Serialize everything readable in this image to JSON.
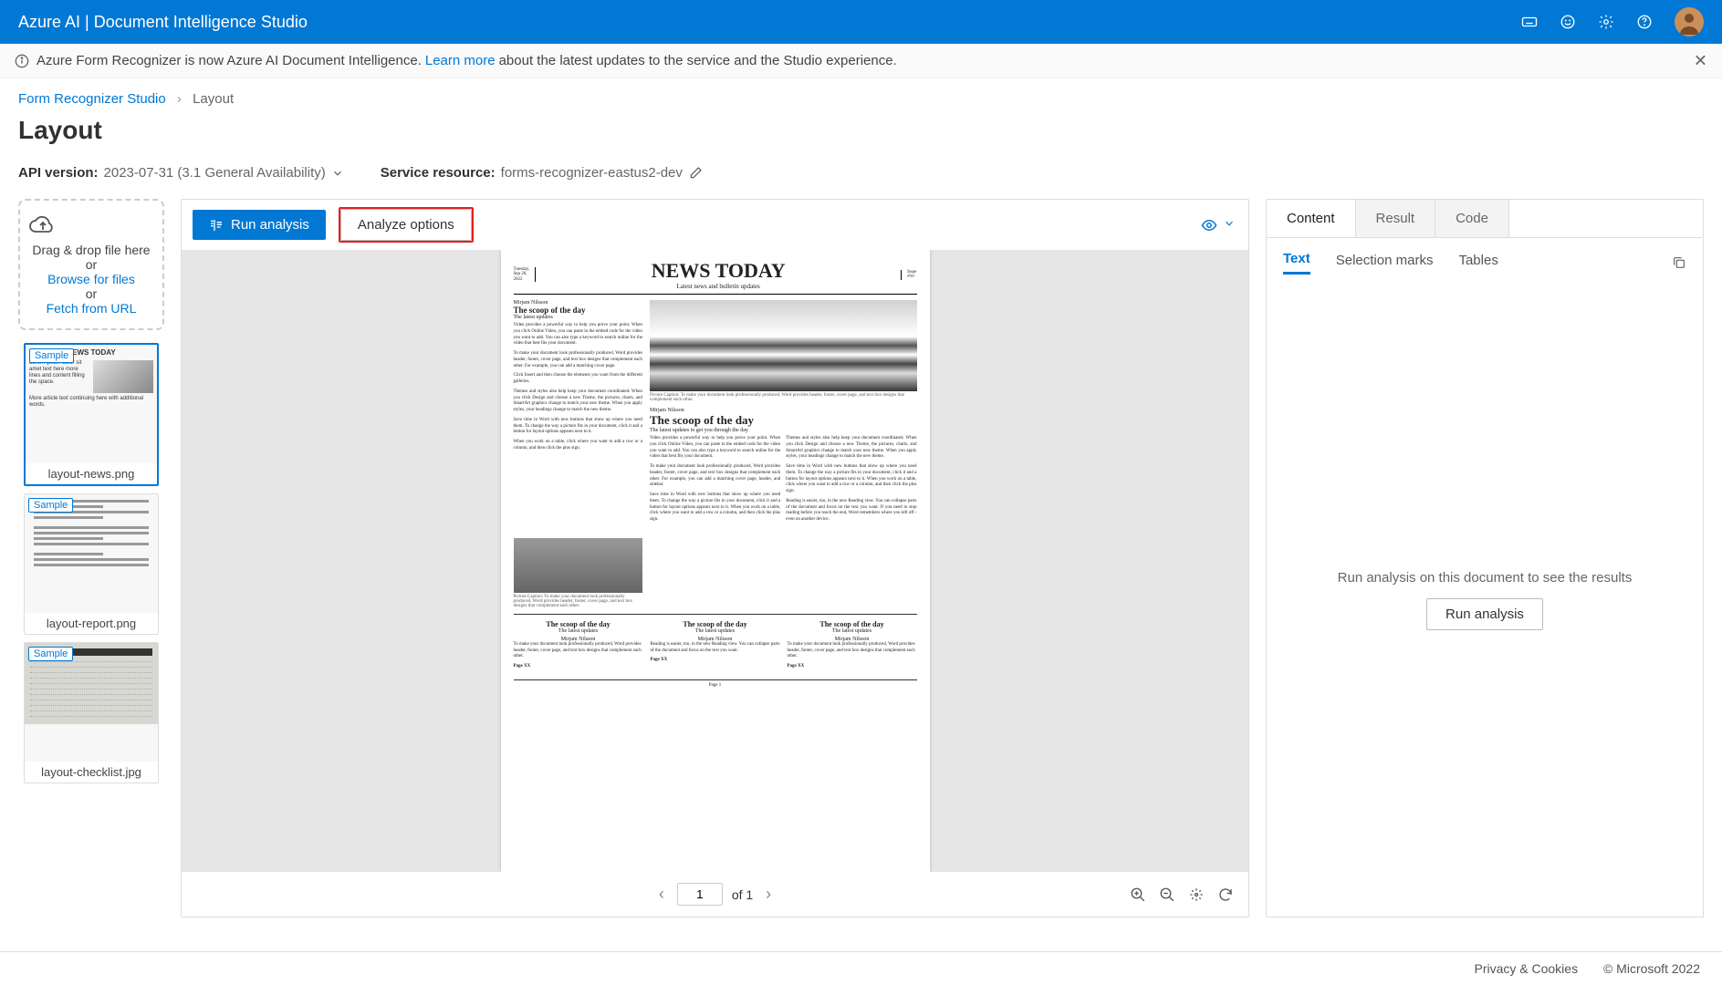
{
  "topbar": {
    "title": "Azure AI | Document Intelligence Studio"
  },
  "notice": {
    "prefix": "Azure Form Recognizer is now Azure AI Document Intelligence.",
    "link": "Learn more",
    "suffix": "about the latest updates to the service and the Studio experience."
  },
  "breadcrumb": {
    "root": "Form Recognizer Studio",
    "current": "Layout"
  },
  "page": {
    "title": "Layout"
  },
  "config": {
    "api_label": "API version:",
    "api_value": "2023-07-31 (3.1 General Availability)",
    "resource_label": "Service resource:",
    "resource_value": "forms-recognizer-eastus2-dev"
  },
  "dropzone": {
    "line1": "Drag & drop file here or",
    "browse": "Browse for files",
    "or": "or",
    "fetch": "Fetch from URL"
  },
  "thumbnails": [
    {
      "name": "layout-news.png",
      "sample": "Sample",
      "selected": true,
      "kind": "news"
    },
    {
      "name": "layout-report.png",
      "sample": "Sample",
      "selected": false,
      "kind": "report"
    },
    {
      "name": "layout-checklist.jpg",
      "sample": "Sample",
      "selected": false,
      "kind": "checklist"
    }
  ],
  "toolbar": {
    "run": "Run analysis",
    "options": "Analyze options"
  },
  "pager": {
    "current": "1",
    "of": "of 1"
  },
  "tabs": {
    "content": "Content",
    "result": "Result",
    "code": "Code"
  },
  "subtabs": {
    "text": "Text",
    "selection": "Selection marks",
    "tables": "Tables"
  },
  "rp_body": {
    "hint": "Run analysis on this document to see the results",
    "run": "Run analysis"
  },
  "footer": {
    "privacy": "Privacy & Cookies",
    "copyright": "© Microsoft 2022"
  },
  "newspaper": {
    "date1": "Tuesday,",
    "date2": "Sep 20,",
    "date3": "2022",
    "title": "NEWS TODAY",
    "subtitle": "Latest news and bulletin updates",
    "issue1": "Issue",
    "issue2": "#10",
    "author": "Mirjam Nilsson",
    "h1": "The scoop of the day",
    "sub1": "The latest updates",
    "sub2": "The latest updates to get you through the day",
    "page_xx": "Page XX",
    "page1": "Page 1"
  }
}
